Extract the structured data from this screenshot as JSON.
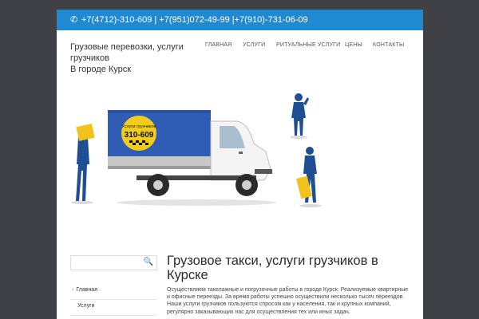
{
  "topbar": {
    "phone_icon": "phone-icon",
    "phones": "+7(4712)-310-609 | +7(951)072-49-99 |+7(910)-731-06-09"
  },
  "site": {
    "title_line1": "Грузовые перевозки, услуги грузчиков",
    "title_line2": "В городе Курск"
  },
  "nav": {
    "items": [
      "ГЛАВНАЯ",
      "УСЛУГИ",
      "РИТУАЛЬНЫЕ УСЛУГИ",
      "ЦЕНЫ",
      "КОНТАКТЫ"
    ]
  },
  "hero": {
    "sign_line1": "Услуги грузчиков",
    "sign_line2": "310-609"
  },
  "sidebar": {
    "search_placeholder": "",
    "items": [
      "Главная",
      "Услуги"
    ]
  },
  "main": {
    "title": "Грузовое такси, услуги грузчиков в Курске",
    "text": "Осуществляем такелажные и погрузочные работы в городе Курск. Реализуемые квартирные и офисные переезды. За время работы успешно осуществили несколько тысяч переездов. Наши услуги грузчиков пользуются спросом как у населения, так и крупных компаний, регулярно заказывающих нас для осуществления тех или иных задач."
  },
  "colors": {
    "background": "#3f4147",
    "topbar": "#1f8ad1",
    "truck_tarp": "#2f5db3",
    "sign": "#f2cc1a"
  }
}
